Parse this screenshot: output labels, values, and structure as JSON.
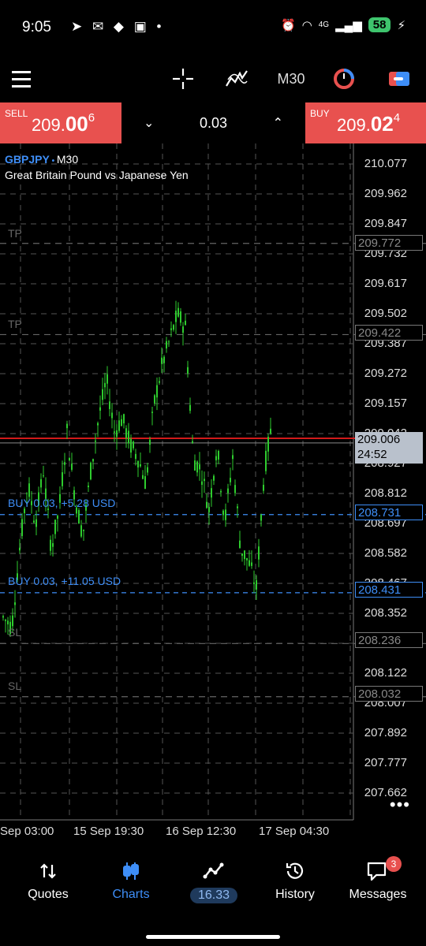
{
  "status": {
    "time": "9:05",
    "battery": "58",
    "network": "4G"
  },
  "toolbar": {
    "timeframe": "M30"
  },
  "trade": {
    "sell_label": "SELL",
    "sell_price_main": "209.",
    "sell_price_big": "00",
    "sell_price_sup": "6",
    "buy_label": "BUY",
    "buy_price_main": "209.",
    "buy_price_big": "02",
    "buy_price_sup": "4",
    "volume": "0.03"
  },
  "chart": {
    "symbol": "GBPJPY",
    "symbol_sep": " • ",
    "timeframe": "M30",
    "description": "Great Britain Pound vs Japanese Yen",
    "price_labels": [
      "210.077",
      "209.962",
      "209.847",
      "209.732",
      "209.617",
      "209.502",
      "209.387",
      "209.272",
      "209.157",
      "209.042",
      "208.927",
      "208.812",
      "208.697",
      "208.582",
      "208.467",
      "208.352",
      "208.237",
      "208.122",
      "208.007",
      "207.892",
      "207.777",
      "207.662"
    ],
    "tags": {
      "tp1": "209.772",
      "tp2": "209.422",
      "current_price": "209.006",
      "countdown": "24:52",
      "pos1": "208.731",
      "pos2": "208.431",
      "sl1": "208.236",
      "sl2": "208.032"
    },
    "line_labels": {
      "tp1": "TP",
      "tp2": "TP",
      "pos1": "BUY 0.03,  +5.28 USD",
      "pos2": "BUY 0.03,  +11.05 USD",
      "sl1": "SL",
      "sl2": "SL"
    },
    "time_labels": [
      "Sep 03:00",
      "15 Sep 19:30",
      "16 Sep 12:30",
      "17 Sep 04:30"
    ],
    "colors": {
      "candle": "#2ecc2e",
      "position": "#3e8ef7",
      "bid": "#d11a1a",
      "grid": "#555555"
    }
  },
  "nav": {
    "items": [
      {
        "label": "Quotes",
        "icon": "quotes-icon"
      },
      {
        "label": "Charts",
        "icon": "charts-icon"
      },
      {
        "label": "16.33",
        "icon": "trade-icon"
      },
      {
        "label": "History",
        "icon": "history-icon"
      },
      {
        "label": "Messages",
        "icon": "messages-icon"
      }
    ],
    "messages_badge": "3"
  }
}
